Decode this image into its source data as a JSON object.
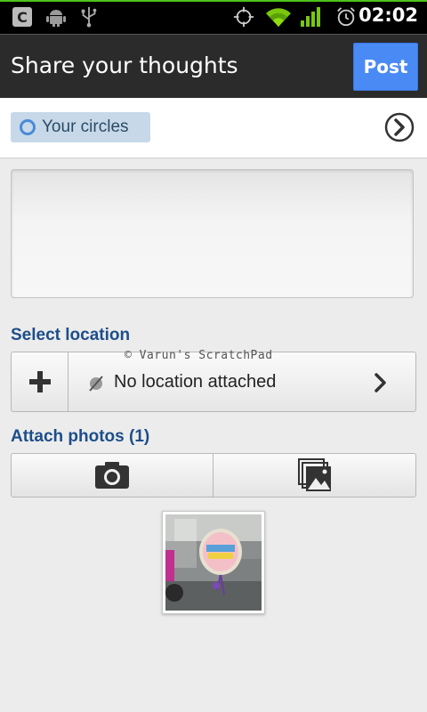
{
  "status_bar": {
    "time": "02:02",
    "icons": [
      "app-c-icon",
      "android-debug-icon",
      "usb-icon",
      "gps-icon",
      "wifi-icon",
      "signal-icon",
      "alarm-icon"
    ],
    "accent_color": "#4ec21a"
  },
  "action_bar": {
    "title": "Share your thoughts",
    "post_label": "Post",
    "post_color": "#4a8af4"
  },
  "circles": {
    "label": "Your circles",
    "chip_color": "#c7d9e8"
  },
  "message": {
    "value": "",
    "placeholder": ""
  },
  "location": {
    "section_label": "Select location",
    "status_text": "No location attached",
    "add_icon": "plus-icon",
    "watermark": "© Varun's ScratchPad"
  },
  "photos": {
    "section_label": "Attach photos (1)",
    "camera_icon": "camera-icon",
    "gallery_icon": "gallery-icon",
    "thumbnails": [
      "birthday-balloon-photo"
    ]
  },
  "colors": {
    "section_label": "#1d4e89",
    "action_bar_bg": "#2b2b2b"
  }
}
